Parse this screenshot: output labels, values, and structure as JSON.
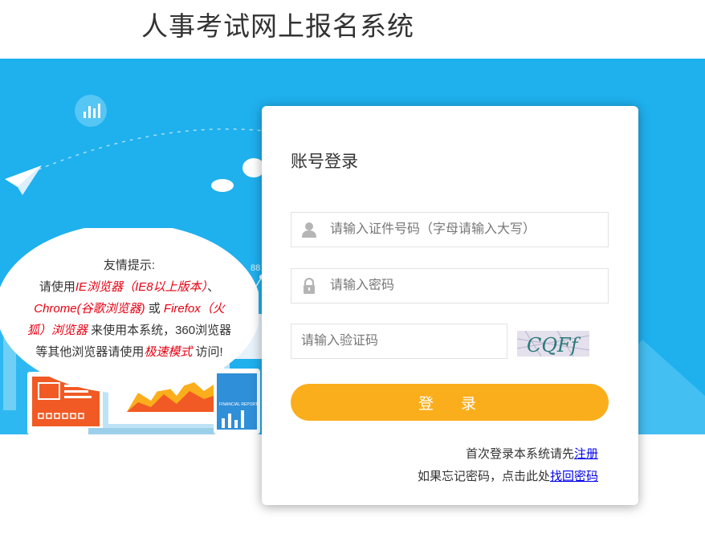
{
  "header": {
    "title": "人事考试网上报名系统"
  },
  "tip": {
    "heading": "友情提示:",
    "line1_prefix": "请使用",
    "line1_red": "IE浏览器（IE8以上版本）",
    "line1_suffix": "、",
    "line2_red_a": "Chrome(谷歌浏览器)",
    "line2_mid": " 或 ",
    "line2_red_b": "Firefox（火",
    "line3_red": "狐）浏览器",
    "line3_suffix": " 来使用本系统，360浏览器",
    "line4_prefix": "等其他浏览器请使用",
    "line4_red": "极速模式",
    "line4_suffix": " 访问!"
  },
  "login": {
    "title": "账号登录",
    "id_placeholder": "请输入证件号码（字母请输入大写）",
    "password_placeholder": "请输入密码",
    "captcha_placeholder": "请输入验证码",
    "captcha_text": "CQFf",
    "button_label": "登 录",
    "register_prefix": "首次登录本系统请先",
    "register_link": "注册",
    "forgot_prefix": "如果忘记密码，点击此处",
    "forgot_link": "找回密码"
  },
  "banner": {
    "chart_label": "FINANCIAL REPORT",
    "number_label": "88"
  },
  "colors": {
    "banner_blue": "#1fb0ee",
    "button_orange": "#fbae1c",
    "tip_red": "#e60012",
    "link_blue": "#0000ee"
  },
  "icons": {
    "user_field": "user-icon",
    "password_field": "lock-icon",
    "banner_paperplane": "paper-plane-icon",
    "banner_stats": "bar-chart-icon"
  }
}
